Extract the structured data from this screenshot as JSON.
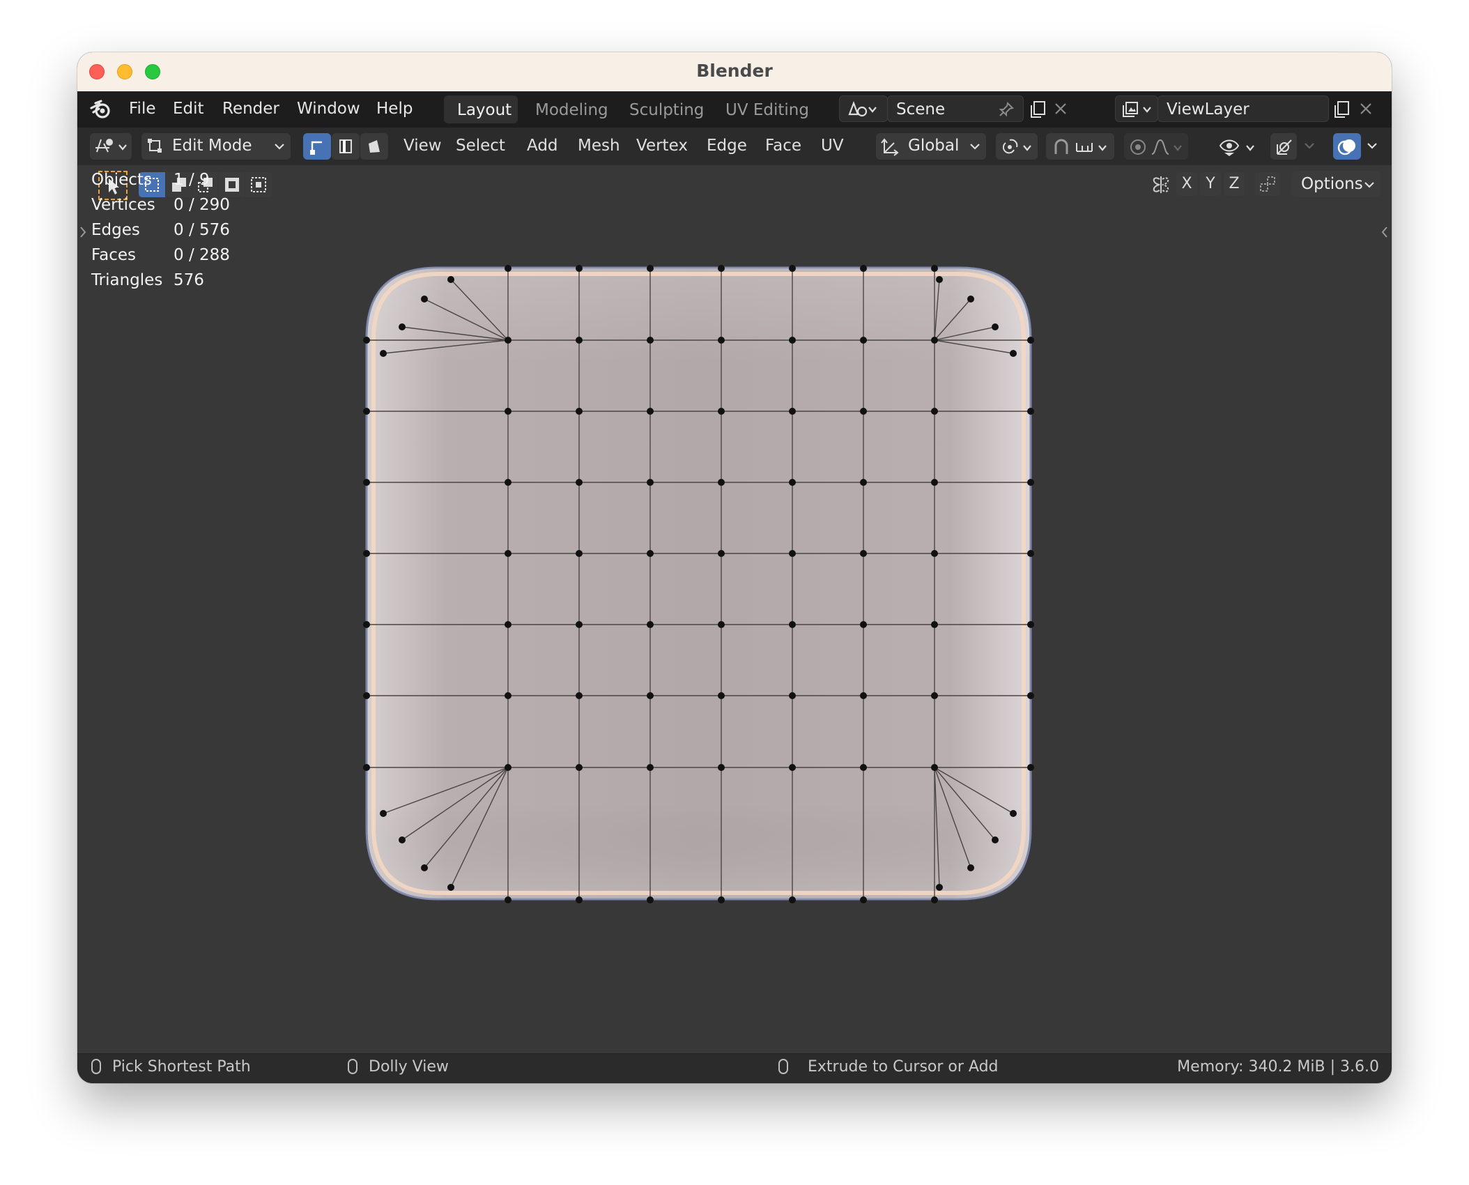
{
  "window": {
    "title": "Blender"
  },
  "topbar": {
    "menus": [
      "File",
      "Edit",
      "Render",
      "Window",
      "Help"
    ],
    "workspaces": [
      "Layout",
      "Modeling",
      "Sculpting",
      "UV Editing"
    ],
    "active_workspace": "Layout",
    "scene": "Scene",
    "view_layer": "ViewLayer"
  },
  "header": {
    "mode": "Edit Mode",
    "menus": [
      "View",
      "Select",
      "Add",
      "Mesh",
      "Vertex",
      "Edge",
      "Face",
      "UV"
    ],
    "orientation": "Global"
  },
  "tools": {
    "axes": [
      "X",
      "Y",
      "Z"
    ],
    "options_label": "Options"
  },
  "stats": [
    {
      "label": "Objects",
      "value": "1 / 9"
    },
    {
      "label": "Vertices",
      "value": "0 / 290"
    },
    {
      "label": "Edges",
      "value": "0 / 576"
    },
    {
      "label": "Faces",
      "value": "0 / 288"
    },
    {
      "label": "Triangles",
      "value": "576"
    }
  ],
  "statusbar": {
    "left": "Pick Shortest Path",
    "middle": "Dolly View",
    "right": "Extrude to Cursor or Add",
    "memory": "Memory: 340.2 MiB | 3.6.0"
  },
  "colors": {
    "accent": "#4772b3",
    "select_box": "#e9a33a",
    "mesh_face": "#b8aeae",
    "highlight": "#f3d7c2"
  }
}
